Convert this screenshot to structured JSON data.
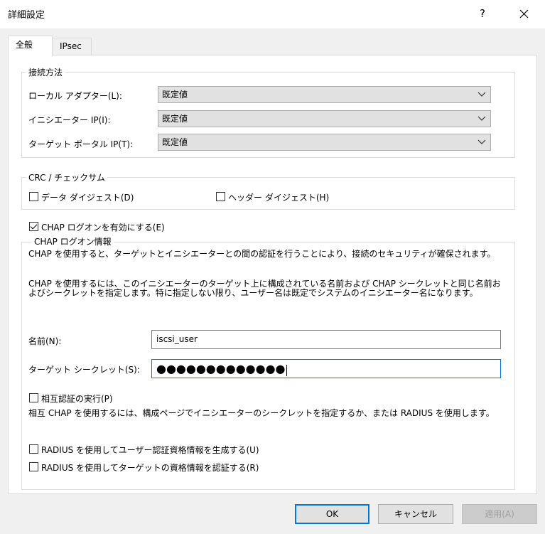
{
  "window": {
    "title": "詳細設定",
    "help_label": "?",
    "close_label": "✕"
  },
  "tabs": [
    {
      "label": "全般",
      "active": true
    },
    {
      "label": "IPsec",
      "active": false
    }
  ],
  "connection": {
    "legend": "接続方法",
    "local_adapter_label": "ローカル アダプター(L):",
    "local_adapter_value": "既定値",
    "initiator_ip_label": "イニシエーター IP(I):",
    "initiator_ip_value": "既定値",
    "target_portal_label": "ターゲット ポータル IP(T):",
    "target_portal_value": "既定値"
  },
  "crc": {
    "legend": "CRC / チェックサム",
    "data_digest_label": "データ ダイジェスト(D)",
    "data_digest_checked": false,
    "header_digest_label": "ヘッダー ダイジェスト(H)",
    "header_digest_checked": false
  },
  "chap": {
    "enable_label": "CHAP ログオンを有効にする(E)",
    "enable_checked": true,
    "legend": "CHAP ログオン情報",
    "desc1": "CHAP を使用すると、ターゲットとイニシエーターとの間の認証を行うことにより、接続のセキュリティが確保されます。",
    "desc2": "CHAP を使用するには、このイニシエーターのターゲット上に構成されている名前および CHAP シークレットと同じ名前およびシークレットを指定します。特に指定しない限り、ユーザー名は既定でシステムのイニシエーター名になります。",
    "name_label": "名前(N):",
    "name_value": "iscsi_user",
    "secret_label": "ターゲット シークレット(S):",
    "secret_value": "●●●●●●●●●●●●●",
    "mutual_label": "相互認証の実行(P)",
    "mutual_checked": false,
    "mutual_desc": "相互 CHAP を使用するには、構成ページでイニシエーターのシークレットを指定するか、または RADIUS を使用します。",
    "radius_user_label": "RADIUS を使用してユーザー認証資格情報を生成する(U)",
    "radius_user_checked": false,
    "radius_target_label": "RADIUS を使用してターゲットの資格情報を認証する(R)",
    "radius_target_checked": false
  },
  "buttons": {
    "ok": "OK",
    "cancel": "キャンセル",
    "apply": "適用(A)"
  },
  "colors": {
    "accent": "#0078d7",
    "dialog_bg": "#f0f0f0",
    "panel_bg": "#ffffff"
  }
}
